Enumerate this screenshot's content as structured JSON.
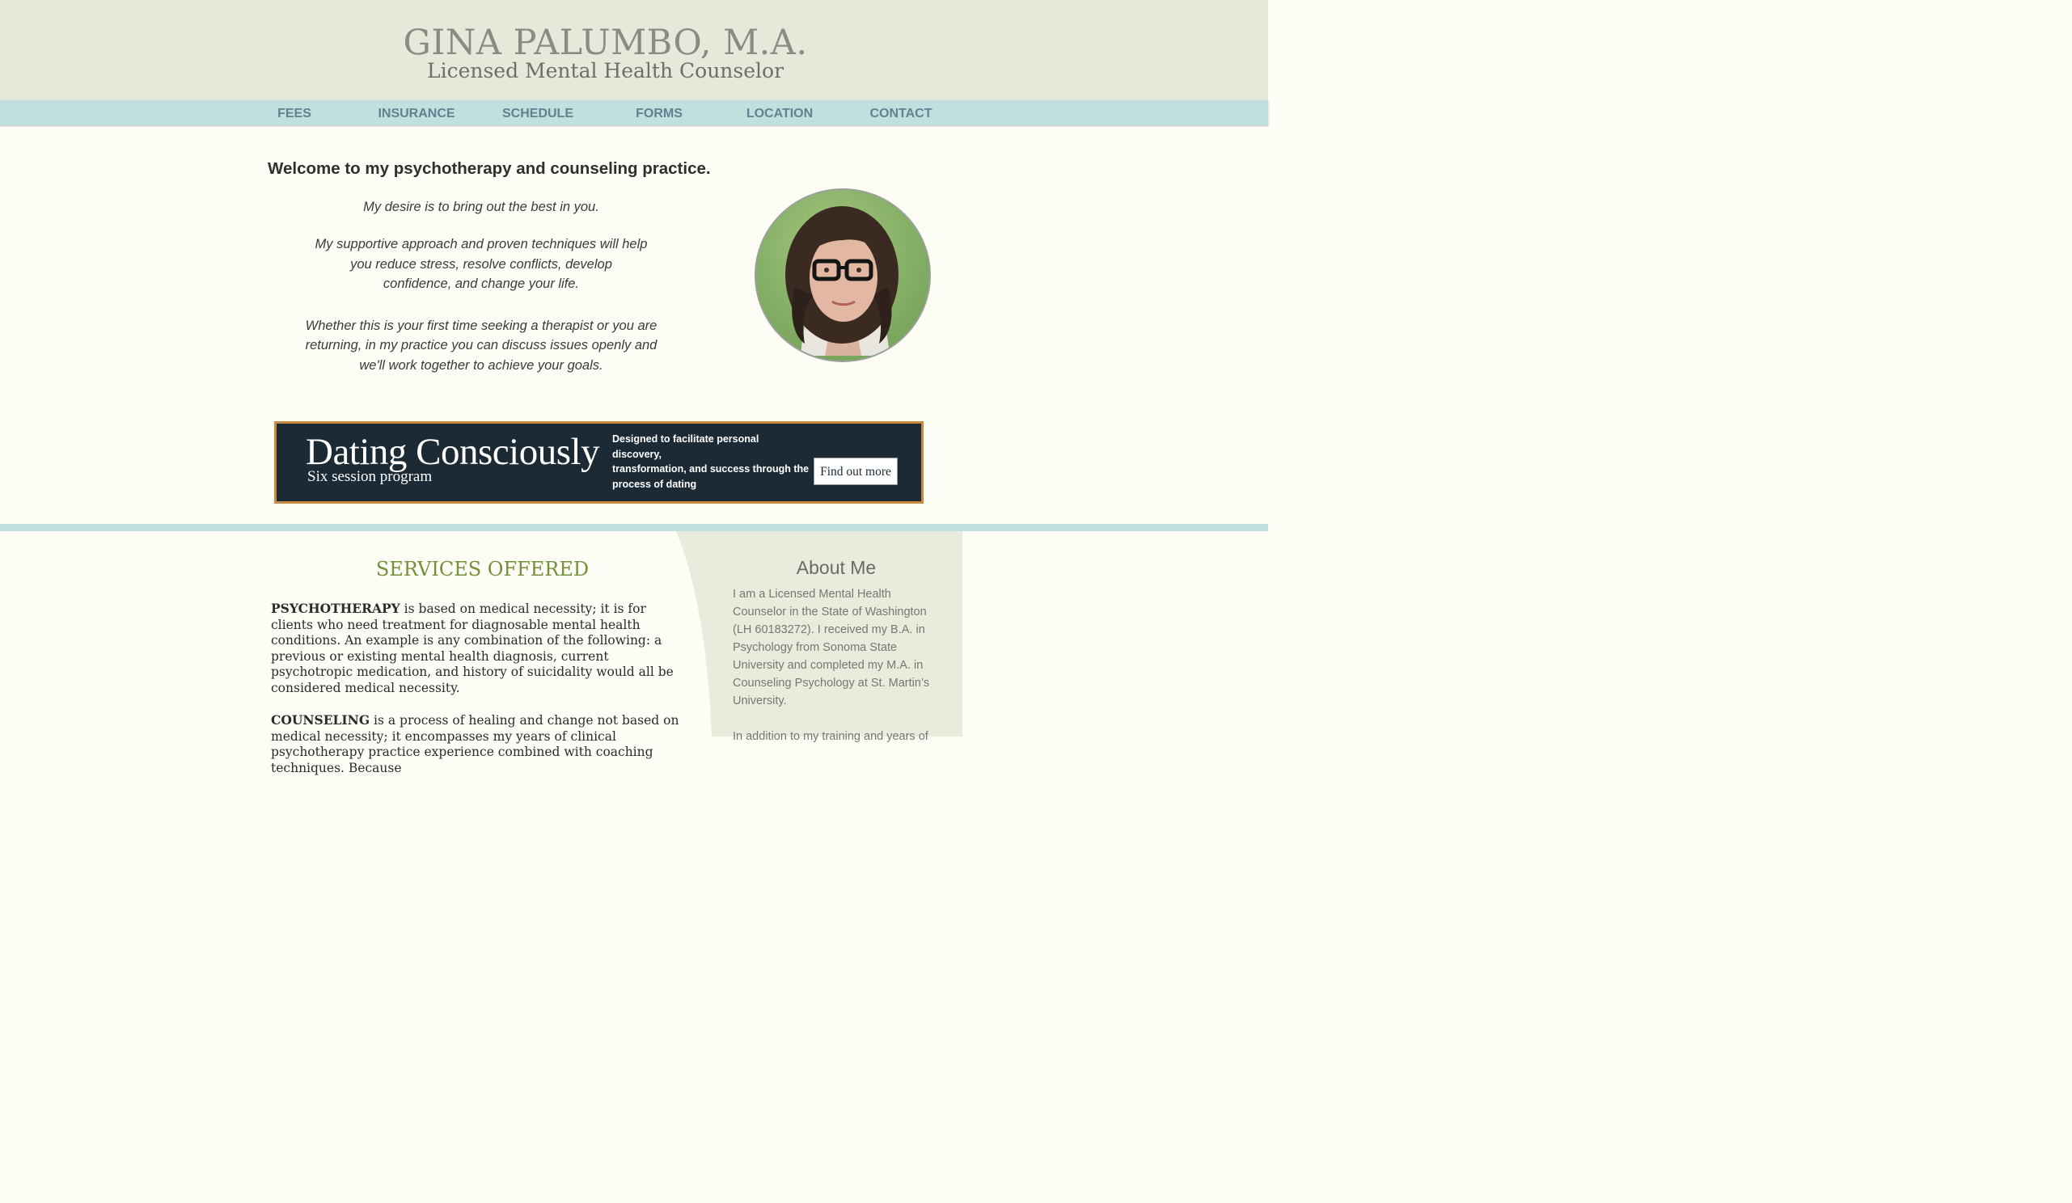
{
  "header": {
    "title": "GINA PALUMBO, M.A.",
    "subtitle": "Licensed Mental Health Counselor"
  },
  "nav": {
    "items": [
      {
        "label": "FEES"
      },
      {
        "label": "INSURANCE"
      },
      {
        "label": "SCHEDULE"
      },
      {
        "label": "FORMS"
      },
      {
        "label": "LOCATION"
      },
      {
        "label": "CONTACT"
      }
    ]
  },
  "welcome": {
    "heading": "Welcome to my psychotherapy and counseling practice.",
    "para1_l1": "My desire is to bring out the best in you.",
    "para2_l1": "My supportive approach and proven techniques will help",
    "para2_l2": "you reduce stress, resolve conflicts, develop",
    "para2_l3": "confidence, and change your life.",
    "para3_l1": "Whether this is your first time seeking a therapist or you are",
    "para3_l2": "returning, in my practice you can discuss issues openly and",
    "para3_l3": "we'll work together to achieve your goals."
  },
  "promo": {
    "title": "Dating Consciously",
    "subtitle": "Six session program",
    "description_l1": "Designed to facilitate personal discovery,",
    "description_l2": "transformation, and success through the",
    "description_l3": "process of dating",
    "button_label": "Find out more"
  },
  "services": {
    "title": "SERVICES OFFERED",
    "psychotherapy_term": "PSYCHOTHERAPY",
    "psychotherapy_text": " is based on medical necessity; it is for clients who need treatment for diagnosable mental health conditions.  An example is any combination of the following: a previous or existing mental health diagnosis, current psychotropic medication, and history of suicidality would all be considered medical necessity.",
    "counseling_term": "COUNSELING",
    "counseling_text": " is a process of healing and change not based on medical necessity; it encompasses my years of clinical psychotherapy practice experience combined with coaching techniques.  Because"
  },
  "about": {
    "title": "About Me",
    "para1": "I am a Licensed Mental Health Counselor in the State of Washington (LH 60183272).  I received my B.A. in Psychology from Sonoma State University and completed my M.A. in Counseling Psychology at St. Martin’s University.",
    "para2": "In addition to my training and years of"
  },
  "colors": {
    "header_bg": "#e5e9da",
    "nav_bg": "#c2dfe0",
    "nav_text": "#5e8290",
    "services_title": "#74903a",
    "promo_bg": "#1b2a35",
    "promo_border": "#c88a3e",
    "about_panel": "#e8ecdd"
  }
}
